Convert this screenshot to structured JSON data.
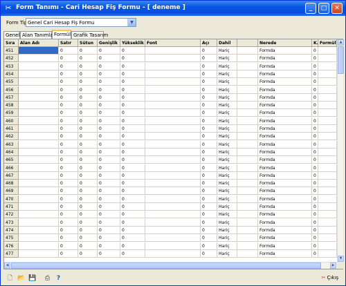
{
  "window": {
    "title": "Form Tanımı - Cari Hesap Fiş Formu - [ deneme ]",
    "minimize": "_",
    "maximize": "□",
    "close": "✕"
  },
  "form_type": {
    "label": "Form Tipi",
    "value": "Genel Cari Hesap Fiş Formu"
  },
  "tabs": [
    "Genel",
    "Alan Tanımları",
    "Formül",
    "Grafik Tasarım"
  ],
  "active_tab": "Formül",
  "grid": {
    "columns": [
      "Sıra",
      "Alan Adı",
      "Satır",
      "Sütun",
      "Genişlik",
      "Yükseklik",
      "Font",
      "Açı",
      "Dahil",
      "",
      "Nerede",
      "K.",
      "Formül"
    ],
    "rows": [
      {
        "sira": "451",
        "satir": "0",
        "sutun": "0",
        "genislik": "0",
        "yukseklik": "0",
        "aci": "0",
        "dahil": "Hariç",
        "nerede": "Formda",
        "k": "0"
      },
      {
        "sira": "452",
        "satir": "0",
        "sutun": "0",
        "genislik": "0",
        "yukseklik": "0",
        "aci": "0",
        "dahil": "Hariç",
        "nerede": "Formda",
        "k": "0"
      },
      {
        "sira": "453",
        "satir": "0",
        "sutun": "0",
        "genislik": "0",
        "yukseklik": "0",
        "aci": "0",
        "dahil": "Hariç",
        "nerede": "Formda",
        "k": "0"
      },
      {
        "sira": "454",
        "satir": "0",
        "sutun": "0",
        "genislik": "0",
        "yukseklik": "0",
        "aci": "0",
        "dahil": "Hariç",
        "nerede": "Formda",
        "k": "0"
      },
      {
        "sira": "455",
        "satir": "0",
        "sutun": "0",
        "genislik": "0",
        "yukseklik": "0",
        "aci": "0",
        "dahil": "Hariç",
        "nerede": "Formda",
        "k": "0"
      },
      {
        "sira": "456",
        "satir": "0",
        "sutun": "0",
        "genislik": "0",
        "yukseklik": "0",
        "aci": "0",
        "dahil": "Hariç",
        "nerede": "Formda",
        "k": "0"
      },
      {
        "sira": "457",
        "satir": "0",
        "sutun": "0",
        "genislik": "0",
        "yukseklik": "0",
        "aci": "0",
        "dahil": "Hariç",
        "nerede": "Formda",
        "k": "0"
      },
      {
        "sira": "458",
        "satir": "0",
        "sutun": "0",
        "genislik": "0",
        "yukseklik": "0",
        "aci": "0",
        "dahil": "Hariç",
        "nerede": "Formda",
        "k": "0"
      },
      {
        "sira": "459",
        "satir": "0",
        "sutun": "0",
        "genislik": "0",
        "yukseklik": "0",
        "aci": "0",
        "dahil": "Hariç",
        "nerede": "Formda",
        "k": "0"
      },
      {
        "sira": "460",
        "satir": "0",
        "sutun": "0",
        "genislik": "0",
        "yukseklik": "0",
        "aci": "0",
        "dahil": "Hariç",
        "nerede": "Formda",
        "k": "0"
      },
      {
        "sira": "461",
        "satir": "0",
        "sutun": "0",
        "genislik": "0",
        "yukseklik": "0",
        "aci": "0",
        "dahil": "Hariç",
        "nerede": "Formda",
        "k": "0"
      },
      {
        "sira": "462",
        "satir": "0",
        "sutun": "0",
        "genislik": "0",
        "yukseklik": "0",
        "aci": "0",
        "dahil": "Hariç",
        "nerede": "Formda",
        "k": "0"
      },
      {
        "sira": "463",
        "satir": "0",
        "sutun": "0",
        "genislik": "0",
        "yukseklik": "0",
        "aci": "0",
        "dahil": "Hariç",
        "nerede": "Formda",
        "k": "0"
      },
      {
        "sira": "464",
        "satir": "0",
        "sutun": "0",
        "genislik": "0",
        "yukseklik": "0",
        "aci": "0",
        "dahil": "Hariç",
        "nerede": "Formda",
        "k": "0"
      },
      {
        "sira": "465",
        "satir": "0",
        "sutun": "0",
        "genislik": "0",
        "yukseklik": "0",
        "aci": "0",
        "dahil": "Hariç",
        "nerede": "Formda",
        "k": "0"
      },
      {
        "sira": "466",
        "satir": "0",
        "sutun": "0",
        "genislik": "0",
        "yukseklik": "0",
        "aci": "0",
        "dahil": "Hariç",
        "nerede": "Formda",
        "k": "0"
      },
      {
        "sira": "467",
        "satir": "0",
        "sutun": "0",
        "genislik": "0",
        "yukseklik": "0",
        "aci": "0",
        "dahil": "Hariç",
        "nerede": "Formda",
        "k": "0"
      },
      {
        "sira": "468",
        "satir": "0",
        "sutun": "0",
        "genislik": "0",
        "yukseklik": "0",
        "aci": "0",
        "dahil": "Hariç",
        "nerede": "Formda",
        "k": "0"
      },
      {
        "sira": "469",
        "satir": "0",
        "sutun": "0",
        "genislik": "0",
        "yukseklik": "0",
        "aci": "0",
        "dahil": "Hariç",
        "nerede": "Formda",
        "k": "0"
      },
      {
        "sira": "470",
        "satir": "0",
        "sutun": "0",
        "genislik": "0",
        "yukseklik": "0",
        "aci": "0",
        "dahil": "Hariç",
        "nerede": "Formda",
        "k": "0"
      },
      {
        "sira": "471",
        "satir": "0",
        "sutun": "0",
        "genislik": "0",
        "yukseklik": "0",
        "aci": "0",
        "dahil": "Hariç",
        "nerede": "Formda",
        "k": "0"
      },
      {
        "sira": "472",
        "satir": "0",
        "sutun": "0",
        "genislik": "0",
        "yukseklik": "0",
        "aci": "0",
        "dahil": "Hariç",
        "nerede": "Formda",
        "k": "0"
      },
      {
        "sira": "473",
        "satir": "0",
        "sutun": "0",
        "genislik": "0",
        "yukseklik": "0",
        "aci": "0",
        "dahil": "Hariç",
        "nerede": "Formda",
        "k": "0"
      },
      {
        "sira": "474",
        "satir": "0",
        "sutun": "0",
        "genislik": "0",
        "yukseklik": "0",
        "aci": "0",
        "dahil": "Hariç",
        "nerede": "Formda",
        "k": "0"
      },
      {
        "sira": "475",
        "satir": "0",
        "sutun": "0",
        "genislik": "0",
        "yukseklik": "0",
        "aci": "0",
        "dahil": "Hariç",
        "nerede": "Formda",
        "k": "0"
      },
      {
        "sira": "476",
        "satir": "0",
        "sutun": "0",
        "genislik": "0",
        "yukseklik": "0",
        "aci": "0",
        "dahil": "Hariç",
        "nerede": "Formda",
        "k": "0"
      },
      {
        "sira": "477",
        "satir": "0",
        "sutun": "0",
        "genislik": "0",
        "yukseklik": "0",
        "aci": "0",
        "dahil": "Hariç",
        "nerede": "Formda",
        "k": "0"
      }
    ]
  },
  "toolbar": {
    "icons": [
      "new-icon",
      "open-icon",
      "save-icon",
      "print-icon",
      "help-icon"
    ],
    "exit_label": "Çıkış"
  },
  "colors": {
    "titlebar": "#0a54e3",
    "selection": "#316ac5",
    "window_bg": "#ece9d8"
  }
}
